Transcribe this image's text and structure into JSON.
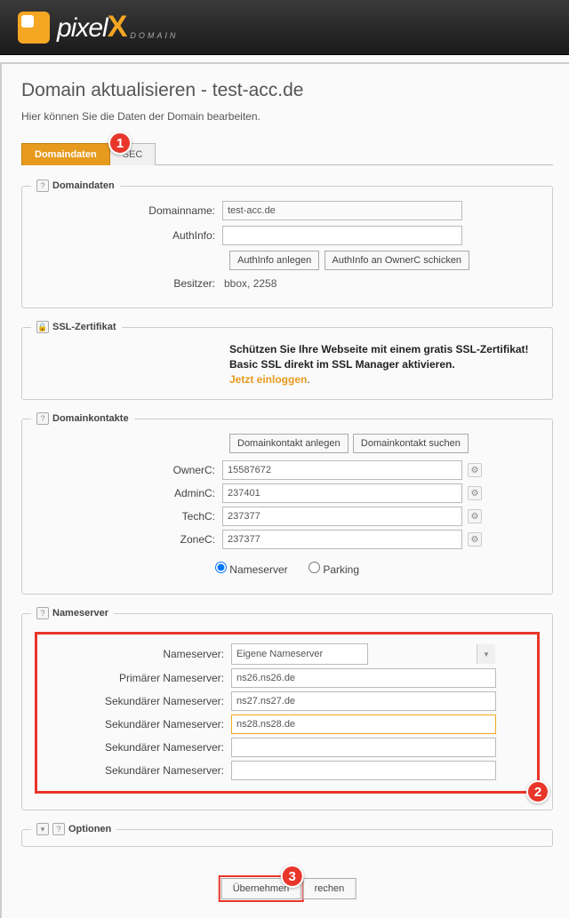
{
  "header": {
    "brand": "pixel",
    "brand_x": "X",
    "brand_sub": "DOMAIN"
  },
  "page": {
    "title": "Domain aktualisieren - test-acc.de",
    "subtitle": "Hier können Sie die Daten der Domain bearbeiten."
  },
  "tabs": {
    "tab1": "Domaindaten",
    "tab2": "SEC"
  },
  "badges": {
    "b1": "1",
    "b2": "2",
    "b3": "3"
  },
  "domaindaten": {
    "legend": "Domaindaten",
    "domainname_label": "Domainname:",
    "domainname_value": "test-acc.de",
    "authinfo_label": "AuthInfo:",
    "authinfo_value": "",
    "btn_authinfo_anlegen": "AuthInfo anlegen",
    "btn_authinfo_send": "AuthInfo an OwnerC schicken",
    "besitzer_label": "Besitzer:",
    "besitzer_value": "bbox, 2258"
  },
  "ssl": {
    "legend": "SSL-Zertifikat",
    "line1": "Schützen Sie Ihre Webseite mit einem gratis SSL-Zertifikat!",
    "line2": "Basic SSL direkt im SSL Manager aktivieren.",
    "link": "Jetzt einloggen",
    "dot": "."
  },
  "kontakte": {
    "legend": "Domainkontakte",
    "btn_anlegen": "Domainkontakt anlegen",
    "btn_suchen": "Domainkontakt suchen",
    "ownerc_label": "OwnerC:",
    "ownerc_value": "15587672",
    "adminc_label": "AdminC:",
    "adminc_value": "237401",
    "techc_label": "TechC:",
    "techc_value": "237377",
    "zonec_label": "ZoneC:",
    "zonec_value": "237377"
  },
  "radio": {
    "nameserver": "Nameserver",
    "parking": "Parking"
  },
  "nameserver": {
    "legend": "Nameserver",
    "ns_label": "Nameserver:",
    "ns_select": "Eigene Nameserver",
    "primary_label": "Primärer Nameserver:",
    "primary_value": "ns26.ns26.de",
    "sec_label": "Sekundärer Nameserver:",
    "sec1": "ns27.ns27.de",
    "sec2": "ns28.ns28.de",
    "sec3": "",
    "sec4": ""
  },
  "optionen": {
    "legend": "Optionen"
  },
  "actions": {
    "submit": "Übernehmen",
    "cancel": "rechen"
  }
}
